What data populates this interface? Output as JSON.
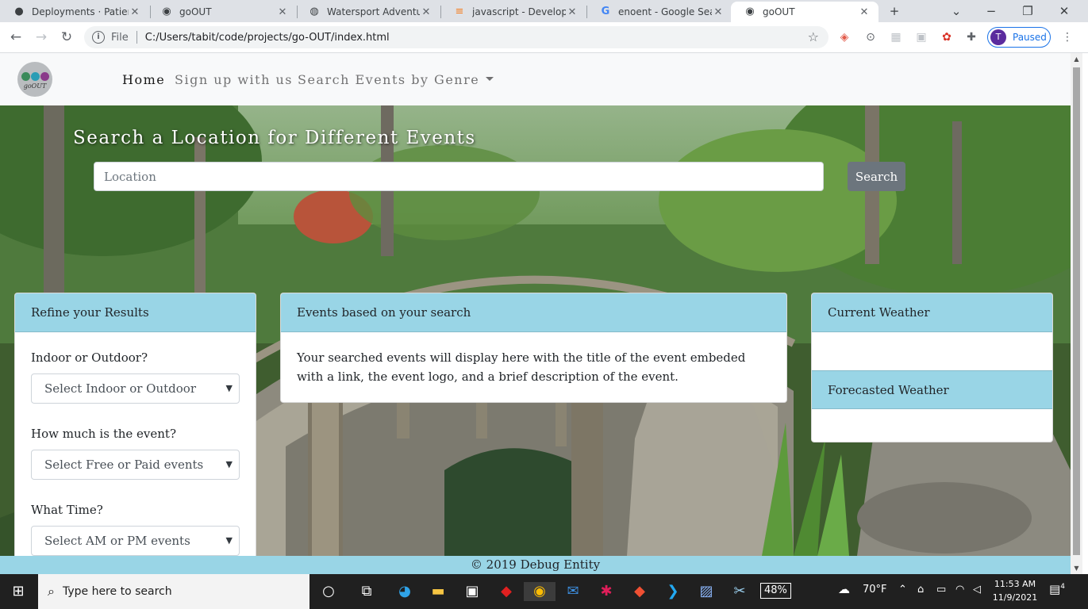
{
  "browser": {
    "tabs": [
      {
        "title": "Deployments · Patienc",
        "icon": "github-icon"
      },
      {
        "title": "goOUT",
        "icon": "goout-icon"
      },
      {
        "title": "Watersport Adventure",
        "icon": "globe-icon"
      },
      {
        "title": "javascript - Developme",
        "icon": "stackoverflow-icon"
      },
      {
        "title": "enoent - Google Searc",
        "icon": "google-icon"
      },
      {
        "title": "goOUT",
        "icon": "goout-icon"
      }
    ],
    "address": {
      "protocol": "File",
      "url": "C:/Users/tabit/code/projects/go-OUT/index.html"
    },
    "profile": {
      "initial": "T",
      "label": "Paused"
    }
  },
  "navbar": {
    "logo_text": "goOUT",
    "links": {
      "home": "Home",
      "signup": "Sign up with us",
      "genre": "Search Events by Genre"
    }
  },
  "hero": {
    "title": "Search a Location for Different Events",
    "location_placeholder": "Location",
    "search_label": "Search"
  },
  "refine": {
    "header": "Refine your Results",
    "indoor_label": "Indoor or Outdoor?",
    "indoor_value": "Select Indoor or Outdoor",
    "cost_label": "How much is the event?",
    "cost_value": "Select Free or Paid events",
    "time_label": "What Time?",
    "time_value": "Select AM or PM events"
  },
  "events": {
    "header": "Events based on your search",
    "body": "Your searched events will display here with the title of the event embeded with a link, the event logo, and a brief description of the event."
  },
  "weather": {
    "current_header": "Current Weather",
    "forecast_header": "Forecasted Weather"
  },
  "footer": {
    "text": "© 2019 Debug Entity"
  },
  "taskbar": {
    "search_placeholder": "Type here to search",
    "battery": "48%",
    "temperature": "70°F",
    "time": "11:53 AM",
    "date": "11/9/2021",
    "notifications": "4"
  },
  "colors": {
    "card_header": "#99d5e6",
    "footer": "#99d5e6",
    "button": "#6c757d",
    "profile": "#1a73e8"
  }
}
